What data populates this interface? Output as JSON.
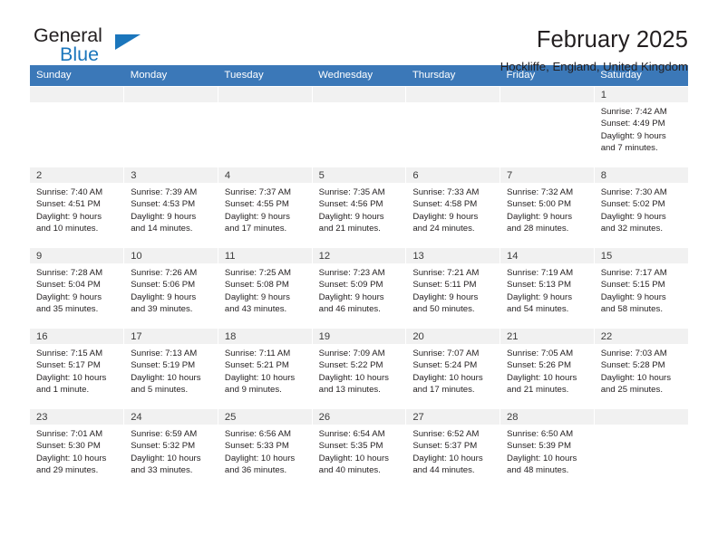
{
  "logo": {
    "primary_text": "General",
    "secondary_text": "Blue",
    "accent_color": "#1b76bc",
    "triangle_icon": "triangle-icon"
  },
  "header": {
    "title": "February 2025",
    "subtitle": "Hockliffe, England, United Kingdom"
  },
  "theme": {
    "header_row_bg": "#3b78b8",
    "header_row_text": "#ffffff",
    "daynum_bg": "#f1f1f1",
    "body_text": "#231f20"
  },
  "weekdays": [
    "Sunday",
    "Monday",
    "Tuesday",
    "Wednesday",
    "Thursday",
    "Friday",
    "Saturday"
  ],
  "weeks": [
    [
      {
        "day": "",
        "sunrise": "",
        "sunset": "",
        "daylight": "",
        "empty": true
      },
      {
        "day": "",
        "sunrise": "",
        "sunset": "",
        "daylight": "",
        "empty": true
      },
      {
        "day": "",
        "sunrise": "",
        "sunset": "",
        "daylight": "",
        "empty": true
      },
      {
        "day": "",
        "sunrise": "",
        "sunset": "",
        "daylight": "",
        "empty": true
      },
      {
        "day": "",
        "sunrise": "",
        "sunset": "",
        "daylight": "",
        "empty": true
      },
      {
        "day": "",
        "sunrise": "",
        "sunset": "",
        "daylight": "",
        "empty": true
      },
      {
        "day": "1",
        "sunrise": "Sunrise: 7:42 AM",
        "sunset": "Sunset: 4:49 PM",
        "daylight": "Daylight: 9 hours and 7 minutes."
      }
    ],
    [
      {
        "day": "2",
        "sunrise": "Sunrise: 7:40 AM",
        "sunset": "Sunset: 4:51 PM",
        "daylight": "Daylight: 9 hours and 10 minutes."
      },
      {
        "day": "3",
        "sunrise": "Sunrise: 7:39 AM",
        "sunset": "Sunset: 4:53 PM",
        "daylight": "Daylight: 9 hours and 14 minutes."
      },
      {
        "day": "4",
        "sunrise": "Sunrise: 7:37 AM",
        "sunset": "Sunset: 4:55 PM",
        "daylight": "Daylight: 9 hours and 17 minutes."
      },
      {
        "day": "5",
        "sunrise": "Sunrise: 7:35 AM",
        "sunset": "Sunset: 4:56 PM",
        "daylight": "Daylight: 9 hours and 21 minutes."
      },
      {
        "day": "6",
        "sunrise": "Sunrise: 7:33 AM",
        "sunset": "Sunset: 4:58 PM",
        "daylight": "Daylight: 9 hours and 24 minutes."
      },
      {
        "day": "7",
        "sunrise": "Sunrise: 7:32 AM",
        "sunset": "Sunset: 5:00 PM",
        "daylight": "Daylight: 9 hours and 28 minutes."
      },
      {
        "day": "8",
        "sunrise": "Sunrise: 7:30 AM",
        "sunset": "Sunset: 5:02 PM",
        "daylight": "Daylight: 9 hours and 32 minutes."
      }
    ],
    [
      {
        "day": "9",
        "sunrise": "Sunrise: 7:28 AM",
        "sunset": "Sunset: 5:04 PM",
        "daylight": "Daylight: 9 hours and 35 minutes."
      },
      {
        "day": "10",
        "sunrise": "Sunrise: 7:26 AM",
        "sunset": "Sunset: 5:06 PM",
        "daylight": "Daylight: 9 hours and 39 minutes."
      },
      {
        "day": "11",
        "sunrise": "Sunrise: 7:25 AM",
        "sunset": "Sunset: 5:08 PM",
        "daylight": "Daylight: 9 hours and 43 minutes."
      },
      {
        "day": "12",
        "sunrise": "Sunrise: 7:23 AM",
        "sunset": "Sunset: 5:09 PM",
        "daylight": "Daylight: 9 hours and 46 minutes."
      },
      {
        "day": "13",
        "sunrise": "Sunrise: 7:21 AM",
        "sunset": "Sunset: 5:11 PM",
        "daylight": "Daylight: 9 hours and 50 minutes."
      },
      {
        "day": "14",
        "sunrise": "Sunrise: 7:19 AM",
        "sunset": "Sunset: 5:13 PM",
        "daylight": "Daylight: 9 hours and 54 minutes."
      },
      {
        "day": "15",
        "sunrise": "Sunrise: 7:17 AM",
        "sunset": "Sunset: 5:15 PM",
        "daylight": "Daylight: 9 hours and 58 minutes."
      }
    ],
    [
      {
        "day": "16",
        "sunrise": "Sunrise: 7:15 AM",
        "sunset": "Sunset: 5:17 PM",
        "daylight": "Daylight: 10 hours and 1 minute."
      },
      {
        "day": "17",
        "sunrise": "Sunrise: 7:13 AM",
        "sunset": "Sunset: 5:19 PM",
        "daylight": "Daylight: 10 hours and 5 minutes."
      },
      {
        "day": "18",
        "sunrise": "Sunrise: 7:11 AM",
        "sunset": "Sunset: 5:21 PM",
        "daylight": "Daylight: 10 hours and 9 minutes."
      },
      {
        "day": "19",
        "sunrise": "Sunrise: 7:09 AM",
        "sunset": "Sunset: 5:22 PM",
        "daylight": "Daylight: 10 hours and 13 minutes."
      },
      {
        "day": "20",
        "sunrise": "Sunrise: 7:07 AM",
        "sunset": "Sunset: 5:24 PM",
        "daylight": "Daylight: 10 hours and 17 minutes."
      },
      {
        "day": "21",
        "sunrise": "Sunrise: 7:05 AM",
        "sunset": "Sunset: 5:26 PM",
        "daylight": "Daylight: 10 hours and 21 minutes."
      },
      {
        "day": "22",
        "sunrise": "Sunrise: 7:03 AM",
        "sunset": "Sunset: 5:28 PM",
        "daylight": "Daylight: 10 hours and 25 minutes."
      }
    ],
    [
      {
        "day": "23",
        "sunrise": "Sunrise: 7:01 AM",
        "sunset": "Sunset: 5:30 PM",
        "daylight": "Daylight: 10 hours and 29 minutes."
      },
      {
        "day": "24",
        "sunrise": "Sunrise: 6:59 AM",
        "sunset": "Sunset: 5:32 PM",
        "daylight": "Daylight: 10 hours and 33 minutes."
      },
      {
        "day": "25",
        "sunrise": "Sunrise: 6:56 AM",
        "sunset": "Sunset: 5:33 PM",
        "daylight": "Daylight: 10 hours and 36 minutes."
      },
      {
        "day": "26",
        "sunrise": "Sunrise: 6:54 AM",
        "sunset": "Sunset: 5:35 PM",
        "daylight": "Daylight: 10 hours and 40 minutes."
      },
      {
        "day": "27",
        "sunrise": "Sunrise: 6:52 AM",
        "sunset": "Sunset: 5:37 PM",
        "daylight": "Daylight: 10 hours and 44 minutes."
      },
      {
        "day": "28",
        "sunrise": "Sunrise: 6:50 AM",
        "sunset": "Sunset: 5:39 PM",
        "daylight": "Daylight: 10 hours and 48 minutes."
      },
      {
        "day": "",
        "sunrise": "",
        "sunset": "",
        "daylight": "",
        "empty": true
      }
    ]
  ]
}
